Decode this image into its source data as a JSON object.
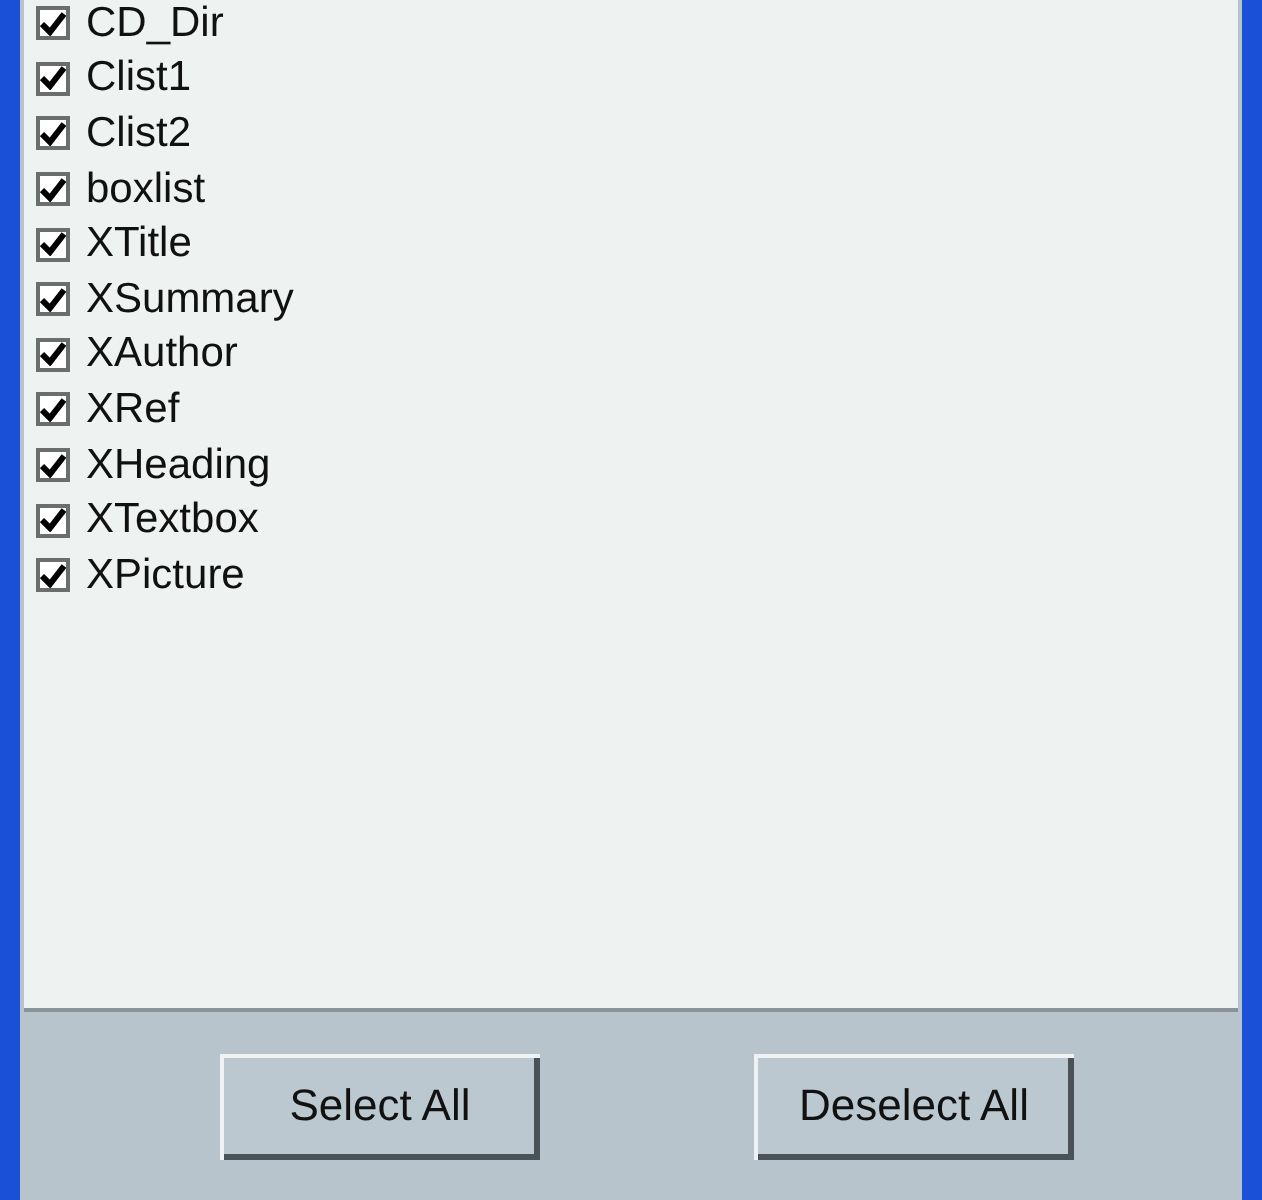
{
  "list": {
    "items": [
      {
        "label": "CD_Dir",
        "checked": true
      },
      {
        "label": "Clist1",
        "checked": true
      },
      {
        "label": "Clist2",
        "checked": true
      },
      {
        "label": "boxlist",
        "checked": true
      },
      {
        "label": "XTitle",
        "checked": true
      },
      {
        "label": "XSummary",
        "checked": true
      },
      {
        "label": "XAuthor",
        "checked": true
      },
      {
        "label": "XRef",
        "checked": true
      },
      {
        "label": "XHeading",
        "checked": true
      },
      {
        "label": "XTextbox",
        "checked": true
      },
      {
        "label": "XPicture",
        "checked": true
      }
    ]
  },
  "buttons": [
    {
      "label": "Select All"
    },
    {
      "label": "Deselect All"
    }
  ]
}
